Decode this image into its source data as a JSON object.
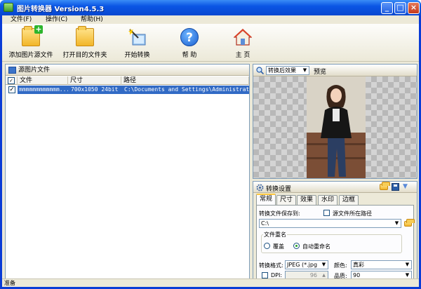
{
  "window": {
    "title": "图片转换器 Version4.5.3",
    "minimize": "_",
    "maximize": "□",
    "close": "×"
  },
  "menu": [
    "文件(F)",
    "操作(C)",
    "帮助(H)"
  ],
  "toolbar": {
    "add_source": "添加图片源文件",
    "open_target": "打开目的文件夹",
    "start_convert": "开始转换",
    "help": "帮 助",
    "home": "主 页"
  },
  "source_panel": {
    "title": "源图片文件",
    "columns": [
      "文件",
      "尺寸",
      "路径"
    ],
    "rows": [
      {
        "checked": true,
        "file": "mmmmmmmmmmmm...",
        "size": "700x1050  24bit",
        "path": "C:\\Documents and Settings\\Administrator..."
      }
    ]
  },
  "preview": {
    "mode": "转换后效果",
    "label": "预览"
  },
  "settings": {
    "title": "转换设置",
    "tabs": [
      "常规",
      "尺寸",
      "效果",
      "水印",
      "边框"
    ],
    "save_to_label": "转换文件保存到:",
    "same_path_label": "源文件所在路径",
    "save_path": "C:\\",
    "rename_group": "文件重名",
    "overwrite": "覆盖",
    "auto_rename": "自动重命名",
    "format_label": "转换格式:",
    "format_value": "JPEG (*.jpg",
    "color_label": "颜色:",
    "color_value": "真彩",
    "dpi_label": "DPI:",
    "dpi_value": "96",
    "quality_label": "品质:",
    "quality_value": "90"
  },
  "status": "准备"
}
